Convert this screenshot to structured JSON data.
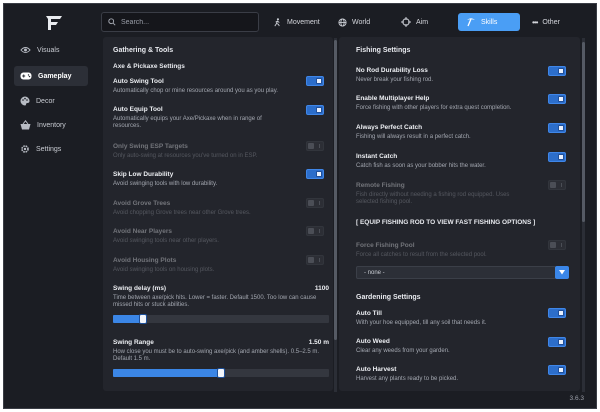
{
  "header": {
    "search": {
      "placeholder": "Search..."
    },
    "tabs": [
      {
        "label": "Movement",
        "icon": "walking-person-icon"
      },
      {
        "label": "World",
        "icon": "globe-icon"
      },
      {
        "label": "Aim",
        "icon": "crosshair-icon"
      },
      {
        "label": "Skills",
        "icon": "pickaxe-icon",
        "active": true
      },
      {
        "label": "Other",
        "icon": "ellipsis-icon"
      }
    ]
  },
  "sidebar": {
    "items": [
      {
        "label": "Visuals",
        "icon": "eye-icon"
      },
      {
        "label": "Gameplay",
        "icon": "gamepad-icon",
        "active": true
      },
      {
        "label": "Decor",
        "icon": "palette-icon"
      },
      {
        "label": "Inventory",
        "icon": "basket-icon"
      },
      {
        "label": "Settings",
        "icon": "gear-icon"
      }
    ]
  },
  "left": {
    "section_title": "Gathering & Tools",
    "subsection_title": "Axe & Pickaxe Settings",
    "rows": [
      {
        "title": "Auto Swing Tool",
        "desc": "Automatically chop or mine resources around you as you play.",
        "on": true,
        "enabled": true
      },
      {
        "title": "Auto Equip Tool",
        "desc": "Automatically equips your Axe/Pickaxe when in range of resources.",
        "on": true,
        "enabled": true
      },
      {
        "title": "Only Swing ESP Targets",
        "desc": "Only auto-swing at resources you've turned on in ESP.",
        "on": false,
        "enabled": false
      },
      {
        "title": "Skip Low Durability",
        "desc": "Avoid swinging tools with low durability.",
        "on": true,
        "enabled": true
      },
      {
        "title": "Avoid Grove Trees",
        "desc": "Avoid chopping Grove trees near other Grove trees.",
        "on": false,
        "enabled": false
      },
      {
        "title": "Avoid Near Players",
        "desc": "Avoid swinging tools near other players.",
        "on": false,
        "enabled": false
      },
      {
        "title": "Avoid Housing Plots",
        "desc": "Avoid swinging tools on housing plots.",
        "on": false,
        "enabled": false
      }
    ],
    "sliders": [
      {
        "title": "Swing delay (ms)",
        "value_label": "1100",
        "desc": "Time between axe/pick hits. Lower = faster. Default 1500. Too low can cause missed hits or stuck abilities.",
        "fraction": 0.14
      },
      {
        "title": "Swing Range",
        "value_label": "1.50 m",
        "desc": "How close you must be to auto-swing axe/pick (and amber shells). 0.5–2.5 m. Default 1.5 m.",
        "fraction": 0.5
      }
    ]
  },
  "right": {
    "section_title": "Fishing Settings",
    "rows": [
      {
        "title": "No Rod Durability Loss",
        "desc": "Never break your fishing rod.",
        "on": true,
        "enabled": true
      },
      {
        "title": "Enable Multiplayer Help",
        "desc": "Force fishing with other players for extra quest completion.",
        "on": true,
        "enabled": true
      },
      {
        "title": "Always Perfect Catch",
        "desc": "Fishing will always result in a perfect catch.",
        "on": true,
        "enabled": true
      },
      {
        "title": "Instant Catch",
        "desc": "Catch fish as soon as your bobber hits the water.",
        "on": true,
        "enabled": true
      },
      {
        "title": "Remote Fishing",
        "desc": "Fish directly without needing a fishing rod equipped. Uses selected fishing pool.",
        "on": false,
        "enabled": false
      }
    ],
    "notice": "[ EQUIP FISHING ROD TO VIEW FAST FISHING OPTIONS ]",
    "force_pool": {
      "title": "Force Fishing Pool",
      "desc": "Force all catches to result from the selected pool.",
      "on": false,
      "enabled": false
    },
    "pool_dropdown": {
      "value": "- none -"
    },
    "gardening_title": "Gardening Settings",
    "garden_rows": [
      {
        "title": "Auto Till",
        "desc": "With your hoe equipped, till any soil that needs it.",
        "on": true,
        "enabled": true
      },
      {
        "title": "Auto Weed",
        "desc": "Clear any weeds from your garden.",
        "on": true,
        "enabled": true
      },
      {
        "title": "Auto Harvest",
        "desc": "Harvest any plants ready to be picked.",
        "on": true,
        "enabled": true
      }
    ]
  },
  "version": "3.6.3",
  "colors": {
    "accent": "#4a9ef5",
    "background": "#1b1d23",
    "panel": "#23252c"
  }
}
